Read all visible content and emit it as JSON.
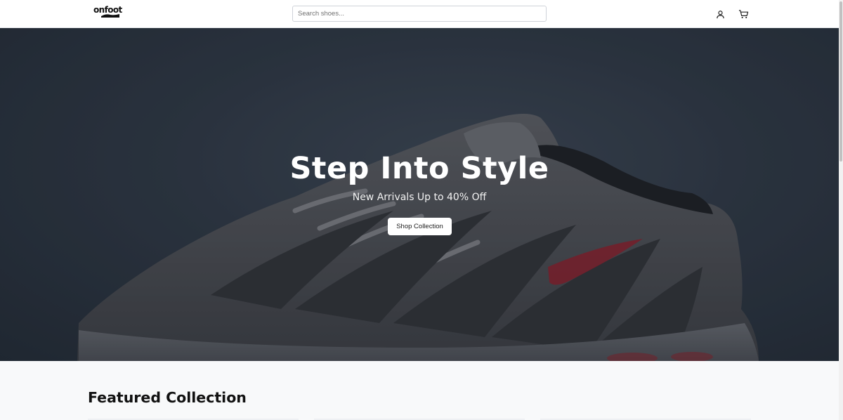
{
  "header": {
    "logo_text": "onfoot",
    "search": {
      "placeholder": "Search shoes...",
      "value": ""
    },
    "icons": [
      "user-icon",
      "cart-icon"
    ]
  },
  "hero": {
    "title": "Step Into Style",
    "subtitle": "New Arrivals Up to 40% Off",
    "button_label": "Shop Collection"
  },
  "featured": {
    "title": "Featured Collection"
  },
  "colors": {
    "hero_background": "#2e3744",
    "page_background": "#f8f9fa",
    "swoosh": "#8a1f2b"
  }
}
